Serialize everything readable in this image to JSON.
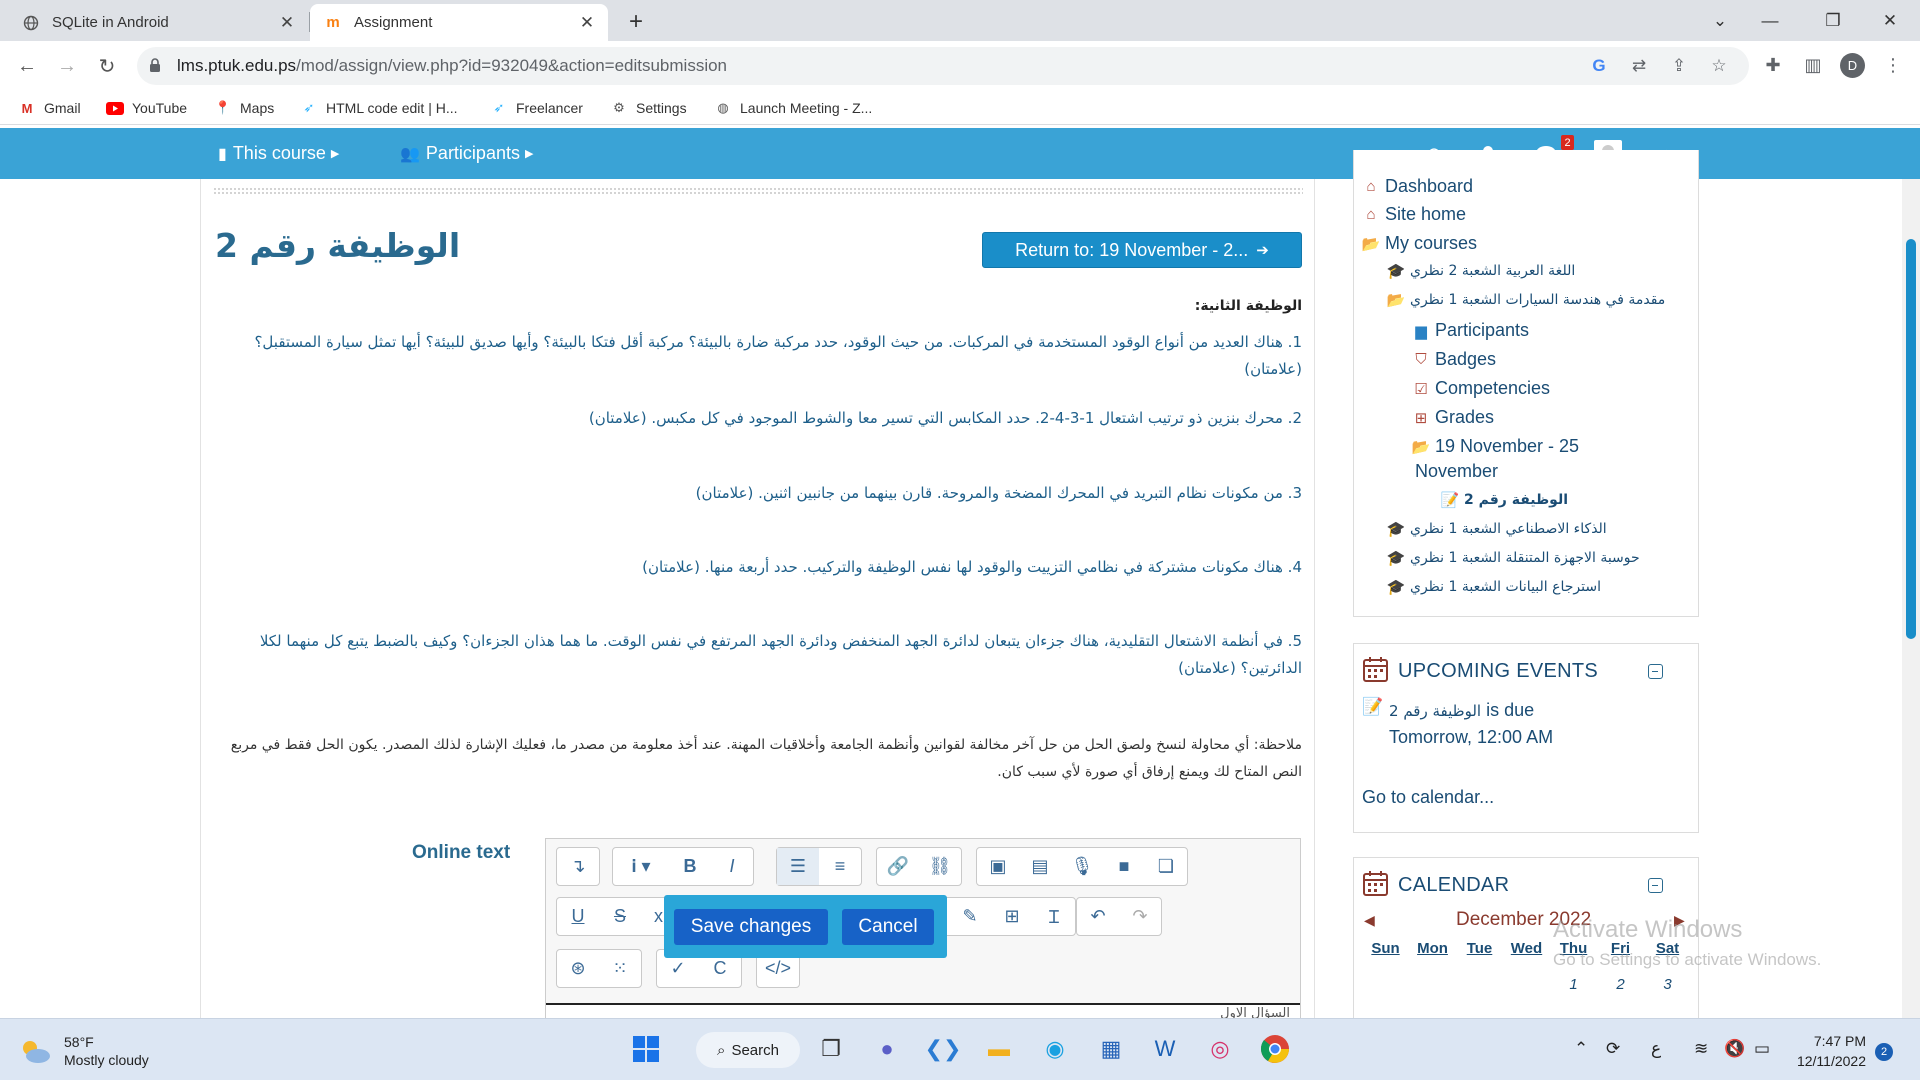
{
  "browser": {
    "tabs": [
      {
        "title": "SQLite in Android",
        "active": false
      },
      {
        "title": "Assignment",
        "active": true
      }
    ],
    "url_host": "lms.ptuk.edu.ps",
    "url_path": "/mod/assign/view.php?id=932049&action=editsubmission",
    "profile_initial": "D",
    "bookmarks": [
      "Gmail",
      "YouTube",
      "Maps",
      "HTML code edit | H...",
      "Freelancer",
      "Settings",
      "Launch Meeting - Z..."
    ]
  },
  "moodle_nav": {
    "this_course": "This course",
    "participants": "Participants",
    "messages_count": "2",
    "user_name": "ضحى"
  },
  "main": {
    "heading": "الوظيفة رقم 2",
    "return_button": "Return to: 19 November - 2...",
    "section_title": "الوظيفة الثانية:",
    "questions": [
      "1. هناك العديد من أنواع الوقود المستخدمة في المركبات. من حيث الوقود، حدد مركبة ضارة بالبيئة؟ مركبة أقل فتكا بالبيئة؟ وأيها صديق للبيئة؟ أيها تمثل سيارة المستقبل؟ (علامتان)",
      "2. محرك بنزين ذو ترتيب اشتعال 1-3-4-2. حدد المكابس التي تسير معا والشوط الموجود في كل مكبس. (علامتان)",
      "3. من مكونات نظام التبريد في المحرك المضخة والمروحة. قارن بينهما من جانبين اثنين. (علامتان)",
      "4. هناك مكونات مشتركة في نظامي التزييت والوقود لها نفس الوظيفة والتركيب. حدد أربعة منها. (علامتان)",
      "5. في أنظمة الاشتعال التقليدية، هناك جزءان يتبعان لدائرة الجهد المنخفض ودائرة الجهد المرتفع في نفس الوقت. ما هما هذان الجزءان؟ وكيف بالضبط يتبع كل منهما لكلا الدائرتين؟ (علامتان)"
    ],
    "note": "ملاحظة: أي محاولة لنسخ ولصق الحل من حل آخر مخالفة لقوانين وأنظمة الجامعة وأخلاقيات المهنة. عند أخذ معلومة من مصدر ما، فعليك الإشارة لذلك المصدر. يكون الحل فقط في مربع النص المتاح لك ويمنع إرفاق أي صورة لأي سبب كان.",
    "online_text_label": "Online text",
    "editor_placeholder": "السؤال الاول",
    "save_button": "Save changes",
    "cancel_button": "Cancel"
  },
  "navigation": {
    "items": [
      {
        "label": "Dashboard",
        "icon": "dashboard-icon"
      },
      {
        "label": "Site home",
        "icon": "home-icon"
      },
      {
        "label": "My courses",
        "icon": "folder-open-icon"
      }
    ],
    "courses": [
      "اللغة العربية الشعبة 2 نظري",
      "مقدمة في هندسة السيارات الشعبة 1 نظري",
      "الذكاء الاصطناعي الشعبة 1 نظري",
      "حوسبة الاجهزة المتنقلة الشعبة 1 نظري",
      "استرجاع البيانات الشعبة 1 نظري"
    ],
    "course_children": [
      "Participants",
      "Badges",
      "Competencies",
      "Grades"
    ],
    "section": "19 November - 25 November",
    "section_line1": "19 November - 25",
    "section_line2": "November",
    "activity": "الوظيفة رقم 2"
  },
  "upcoming": {
    "title": "UPCOMING EVENTS",
    "event_name": "الوظيفة رقم 2",
    "event_suffix": "is due",
    "event_time": "Tomorrow, 12:00 AM",
    "goto": "Go to calendar..."
  },
  "calendar": {
    "title": "CALENDAR",
    "month": "December 2022",
    "weekdays": [
      "Sun",
      "Mon",
      "Tue",
      "Wed",
      "Thu",
      "Fri",
      "Sat"
    ],
    "first_week": [
      "",
      "",
      "",
      "",
      "1",
      "2",
      "3"
    ]
  },
  "watermark": {
    "line1": "Activate Windows",
    "line2": "Go to Settings to activate Windows."
  },
  "taskbar": {
    "temperature": "58°F",
    "condition": "Mostly cloudy",
    "search_label": "Search",
    "time": "7:47 PM",
    "date": "12/11/2022",
    "notifications": "2",
    "input_lang": "ع"
  }
}
